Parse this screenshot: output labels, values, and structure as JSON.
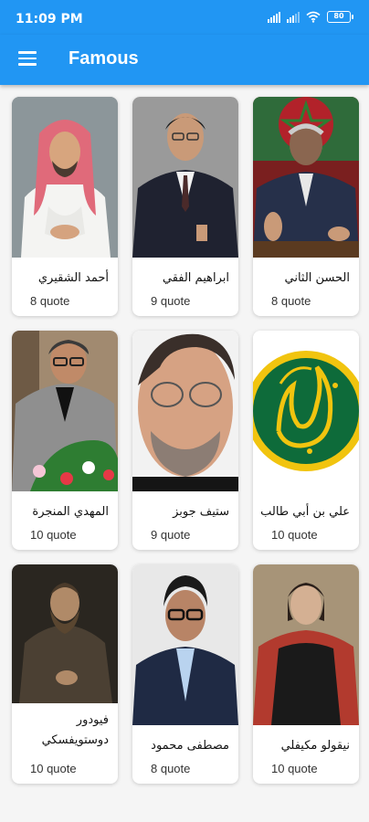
{
  "status_bar": {
    "time": "11:09 PM",
    "battery": "80"
  },
  "app_bar": {
    "title": "Famous"
  },
  "people": [
    {
      "name": "أحمد الشقيري",
      "count": "8 quote"
    },
    {
      "name": "ابراهيم الفقي",
      "count": "9 quote"
    },
    {
      "name": "الحسن الثاني",
      "count": "8 quote"
    },
    {
      "name": "المهدي المنجرة",
      "count": "10 quote"
    },
    {
      "name": "ستيف جوبز",
      "count": "9 quote"
    },
    {
      "name": "علي بن أبي طالب",
      "count": "10 quote"
    },
    {
      "name": "فيودور دوستويفسكي",
      "count": "10 quote"
    },
    {
      "name": "مصطفى محمود",
      "count": "8 quote"
    },
    {
      "name": "نيقولو مكيفلي",
      "count": "10 quote"
    }
  ]
}
